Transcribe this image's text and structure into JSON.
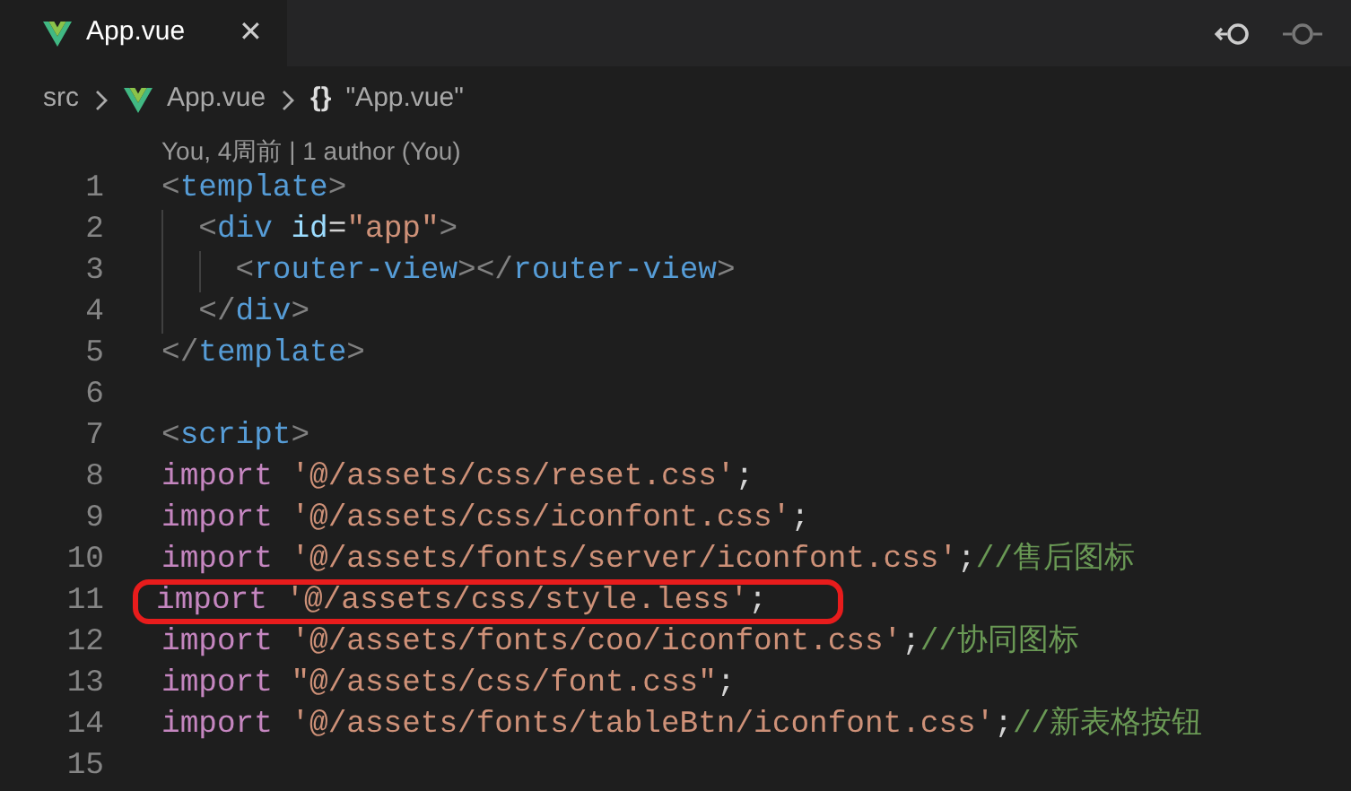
{
  "tabs": [
    {
      "label": "App.vue",
      "selected": true,
      "close": "✕"
    }
  ],
  "breadcrumb": [
    {
      "label": "src",
      "kind": "folder"
    },
    {
      "label": "App.vue",
      "kind": "vue"
    },
    {
      "label": "\"App.vue\"",
      "kind": "object",
      "symbol": "{}"
    }
  ],
  "codelens": "You, 4周前 | 1 author (You)",
  "lines": [
    {
      "number": "1",
      "highlighted": false,
      "tokens": [
        {
          "text": "<",
          "kind": "punct"
        },
        {
          "text": "template",
          "kind": "tag"
        },
        {
          "text": ">",
          "kind": "punct"
        }
      ]
    },
    {
      "number": "2",
      "highlighted": false,
      "tokens": [
        {
          "text": "  <",
          "kind": "punct"
        },
        {
          "text": "div",
          "kind": "tag"
        },
        {
          "text": " id",
          "kind": "attr"
        },
        {
          "text": "=",
          "kind": "plain"
        },
        {
          "text": "\"app\"",
          "kind": "string"
        },
        {
          "text": ">",
          "kind": "punct"
        }
      ]
    },
    {
      "number": "3",
      "highlighted": false,
      "tokens": [
        {
          "text": "    <",
          "kind": "punct"
        },
        {
          "text": "router-view",
          "kind": "tag"
        },
        {
          "text": "></",
          "kind": "punct"
        },
        {
          "text": "router-view",
          "kind": "tag"
        },
        {
          "text": ">",
          "kind": "punct"
        }
      ]
    },
    {
      "number": "4",
      "highlighted": false,
      "tokens": [
        {
          "text": "  </",
          "kind": "punct"
        },
        {
          "text": "div",
          "kind": "tag"
        },
        {
          "text": ">",
          "kind": "punct"
        }
      ]
    },
    {
      "number": "5",
      "highlighted": false,
      "tokens": [
        {
          "text": "</",
          "kind": "punct"
        },
        {
          "text": "template",
          "kind": "tag"
        },
        {
          "text": ">",
          "kind": "punct"
        }
      ]
    },
    {
      "number": "6",
      "highlighted": false
    },
    {
      "number": "7",
      "highlighted": false,
      "tokens": [
        {
          "text": "<",
          "kind": "punct"
        },
        {
          "text": "script",
          "kind": "tag"
        },
        {
          "text": ">",
          "kind": "punct"
        }
      ]
    },
    {
      "number": "8",
      "highlighted": false,
      "tokens": [
        {
          "text": "import",
          "kind": "keyword"
        },
        {
          "text": " '@/assets/css/reset.css'",
          "kind": "string"
        },
        {
          "text": ";",
          "kind": "plain"
        }
      ]
    },
    {
      "number": "9",
      "highlighted": false,
      "tokens": [
        {
          "text": "import",
          "kind": "keyword"
        },
        {
          "text": " '@/assets/css/iconfont.css'",
          "kind": "string"
        },
        {
          "text": ";",
          "kind": "plain"
        }
      ]
    },
    {
      "number": "10",
      "highlighted": false,
      "tokens": [
        {
          "text": "import",
          "kind": "keyword"
        },
        {
          "text": " '@/assets/fonts/server/iconfont.css'",
          "kind": "string"
        },
        {
          "text": ";",
          "kind": "plain"
        },
        {
          "text": "//售后图标",
          "kind": "comment"
        }
      ]
    },
    {
      "number": "11",
      "highlighted": true,
      "tokens": [
        {
          "text": "import",
          "kind": "keyword"
        },
        {
          "text": " '@/assets/css/style.less'",
          "kind": "string"
        },
        {
          "text": ";",
          "kind": "plain"
        }
      ]
    },
    {
      "number": "12",
      "highlighted": false,
      "tokens": [
        {
          "text": "import",
          "kind": "keyword"
        },
        {
          "text": " '@/assets/fonts/coo/iconfont.css'",
          "kind": "string"
        },
        {
          "text": ";",
          "kind": "plain"
        },
        {
          "text": "//协同图标",
          "kind": "comment"
        }
      ]
    },
    {
      "number": "13",
      "highlighted": false,
      "tokens": [
        {
          "text": "import",
          "kind": "keyword"
        },
        {
          "text": " \"@/assets/css/font.css\"",
          "kind": "string"
        },
        {
          "text": ";",
          "kind": "plain"
        }
      ]
    },
    {
      "number": "14",
      "highlighted": false,
      "tokens": [
        {
          "text": "import",
          "kind": "keyword"
        },
        {
          "text": " '@/assets/fonts/tableBtn/iconfont.css'",
          "kind": "string"
        },
        {
          "text": ";",
          "kind": "plain"
        },
        {
          "text": "//新表格按钮",
          "kind": "comment"
        }
      ]
    },
    {
      "number": "15",
      "highlighted": false
    }
  ]
}
